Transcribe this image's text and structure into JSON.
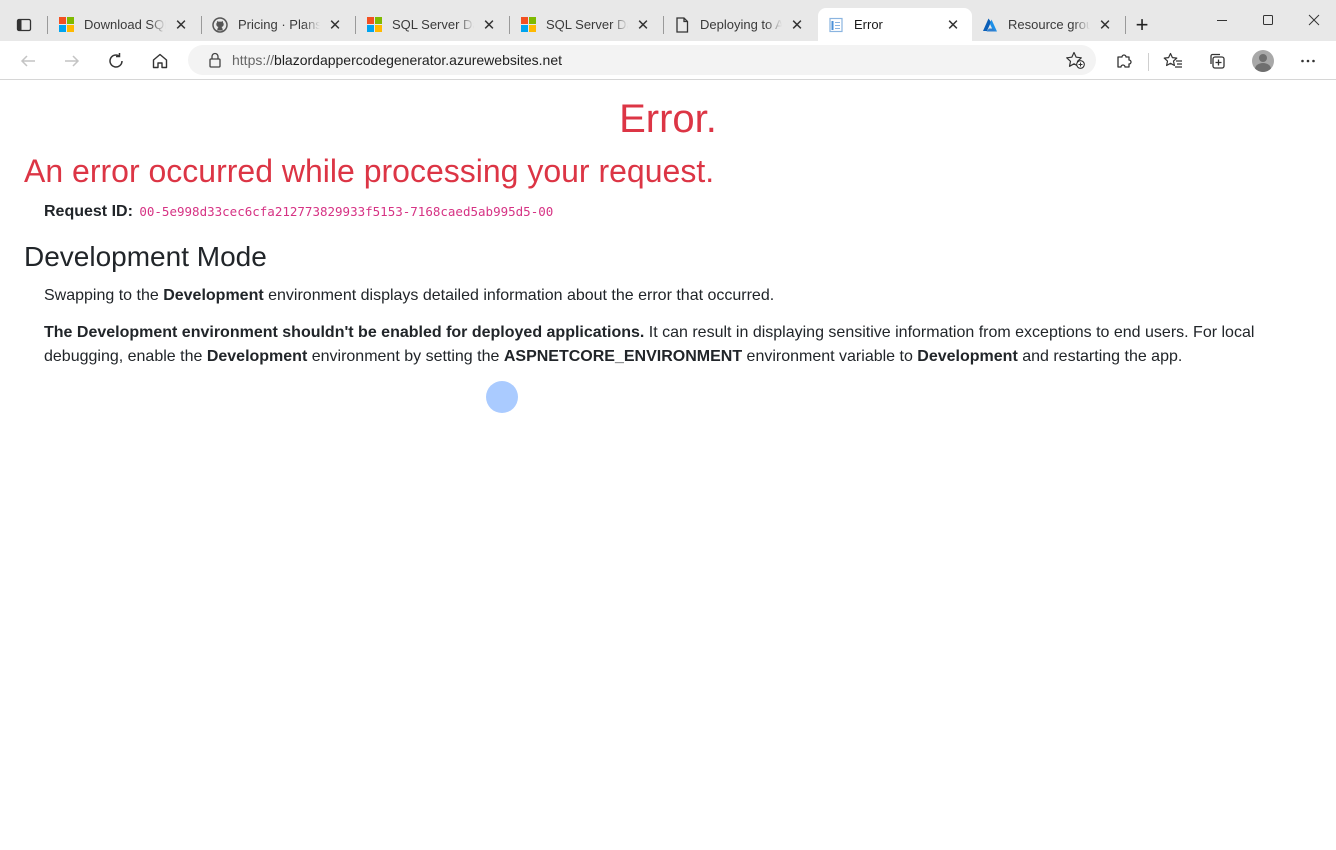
{
  "browser": {
    "tabs": [
      {
        "title": "Download SQL Se",
        "favicon": "microsoft-icon"
      },
      {
        "title": "Pricing · Plans fo",
        "favicon": "github-icon"
      },
      {
        "title": "SQL Server Data",
        "favicon": "microsoft-icon"
      },
      {
        "title": "SQL Server Data",
        "favicon": "microsoft-icon"
      },
      {
        "title": "Deploying to Azu",
        "favicon": "page-icon"
      },
      {
        "title": "Error",
        "favicon": "error-page-icon",
        "active": true
      },
      {
        "title": "Resource groups",
        "favicon": "azure-icon"
      }
    ],
    "address": {
      "url_scheme": "https://",
      "url_host": "blazordappercodegenerator.azurewebsites.net"
    }
  },
  "page": {
    "error_title": "Error.",
    "error_subtitle": "An error occurred while processing your request.",
    "request_id_label": "Request ID:",
    "request_id_value": "00-5e998d33cec6cfa212773829933f5153-7168caed5ab995d5-00",
    "dev_heading": "Development Mode",
    "p1": {
      "t1": "Swapping to the ",
      "b1": "Development",
      "t2": " environment displays detailed information about the error that occurred."
    },
    "p2": {
      "b1": "The Development environment shouldn't be enabled for deployed applications.",
      "t1": " It can result in displaying sensitive information from exceptions to end users. For local debugging, enable the ",
      "b2": "Development",
      "t2": " environment by setting the ",
      "b3": "ASPNETCORE_ENVIRONMENT",
      "t3": " environment variable to ",
      "b4": "Development",
      "t4": " and restarting the app."
    }
  },
  "colors": {
    "error": "#dc3545",
    "code": "#d63384",
    "text": "#212529"
  }
}
